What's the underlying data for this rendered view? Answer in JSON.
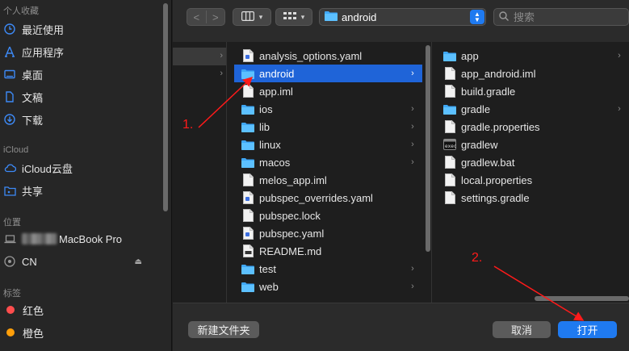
{
  "sidebar": {
    "favorites_title": "个人收藏",
    "favorites": [
      {
        "label": "最近使用",
        "icon": "clock-icon"
      },
      {
        "label": "应用程序",
        "icon": "applications-icon"
      },
      {
        "label": "桌面",
        "icon": "desktop-icon"
      },
      {
        "label": "文稿",
        "icon": "document-icon"
      },
      {
        "label": "下载",
        "icon": "download-icon"
      }
    ],
    "icloud_title": "iCloud",
    "icloud": [
      {
        "label": "iCloud云盘",
        "icon": "cloud-icon"
      },
      {
        "label": "共享",
        "icon": "shared-folder-icon"
      }
    ],
    "locations_title": "位置",
    "locations": [
      {
        "label": "MacBook Pro",
        "icon": "laptop-icon"
      },
      {
        "label": "CN",
        "icon": "network-drive-icon"
      }
    ],
    "tags_title": "标签",
    "tags": [
      {
        "label": "红色",
        "color": "#ff4d4d"
      },
      {
        "label": "橙色",
        "color": "#ff9f0a"
      }
    ]
  },
  "toolbar": {
    "back": "<",
    "forward": ">",
    "current_folder": "android",
    "search_placeholder": "搜索"
  },
  "browser": {
    "column1": [
      {
        "name": "analysis_options.yaml",
        "type": "file",
        "icon": "yaml-file-icon"
      },
      {
        "name": "android",
        "type": "folder",
        "selected": true
      },
      {
        "name": "app.iml",
        "type": "file",
        "icon": "file-icon"
      },
      {
        "name": "ios",
        "type": "folder"
      },
      {
        "name": "lib",
        "type": "folder"
      },
      {
        "name": "linux",
        "type": "folder"
      },
      {
        "name": "macos",
        "type": "folder"
      },
      {
        "name": "melos_app.iml",
        "type": "file",
        "icon": "file-icon"
      },
      {
        "name": "pubspec_overrides.yaml",
        "type": "file",
        "icon": "yaml-file-icon"
      },
      {
        "name": "pubspec.lock",
        "type": "file",
        "icon": "file-icon"
      },
      {
        "name": "pubspec.yaml",
        "type": "file",
        "icon": "yaml-file-icon"
      },
      {
        "name": "README.md",
        "type": "file",
        "icon": "markdown-file-icon"
      },
      {
        "name": "test",
        "type": "folder"
      },
      {
        "name": "web",
        "type": "folder"
      }
    ],
    "column2": [
      {
        "name": "app",
        "type": "folder"
      },
      {
        "name": "app_android.iml",
        "type": "file",
        "icon": "file-icon"
      },
      {
        "name": "build.gradle",
        "type": "file",
        "icon": "file-icon"
      },
      {
        "name": "gradle",
        "type": "folder"
      },
      {
        "name": "gradle.properties",
        "type": "file",
        "icon": "file-icon"
      },
      {
        "name": "gradlew",
        "type": "exec",
        "icon": "terminal-file-icon"
      },
      {
        "name": "gradlew.bat",
        "type": "file",
        "icon": "file-icon"
      },
      {
        "name": "local.properties",
        "type": "file",
        "icon": "file-icon"
      },
      {
        "name": "settings.gradle",
        "type": "file",
        "icon": "file-icon"
      }
    ]
  },
  "buttons": {
    "new_folder": "新建文件夹",
    "cancel": "取消",
    "open": "打开"
  },
  "annotations": {
    "step1": "1.",
    "step2": "2.",
    "color": "#ff1a1a"
  }
}
